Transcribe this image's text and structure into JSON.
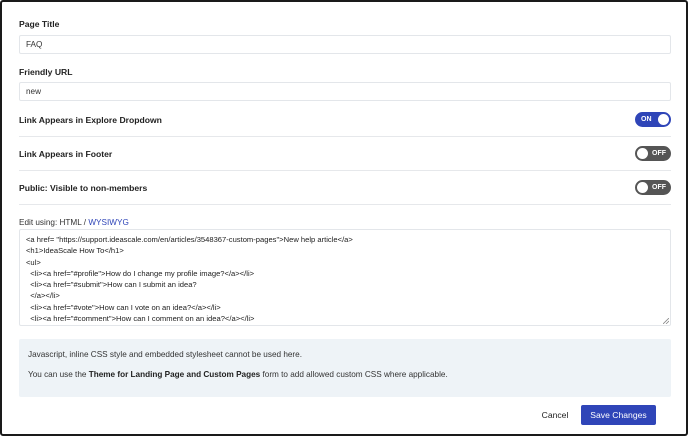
{
  "form": {
    "page_title": {
      "label": "Page Title",
      "value": "FAQ"
    },
    "friendly_url": {
      "label": "Friendly URL",
      "value": "new"
    },
    "toggles": [
      {
        "label": "Link Appears in Explore Dropdown",
        "state": "ON"
      },
      {
        "label": "Link Appears in Footer",
        "state": "OFF"
      },
      {
        "label": "Public: Visible to non-members",
        "state": "OFF"
      }
    ],
    "editor": {
      "prefix": "Edit using: HTML / ",
      "wysiwyg_link": "WYSIWYG",
      "lines": [
        "<a href= \"https://support.ideascale.com/en/articles/3548367-custom-pages\">New help article</a>",
        "<h1>IdeaScale How To</h1>",
        "<ul>",
        "  <li><a href=\"#profile\">How do I change my profile image?</a></li>",
        "  <li><a href=\"#submit\">How can I submit an idea?",
        "  </a></li>",
        "  <li><a href=\"#vote\">How can I vote on an idea?</a></li>",
        "  <li><a href=\"#comment\">How can I comment on an idea?</a></li>"
      ]
    },
    "info": {
      "line1": "Javascript, inline CSS style and embedded stylesheet cannot be used here.",
      "line2_prefix": "You can use the ",
      "line2_bold": "Theme for Landing Page and Custom Pages",
      "line2_suffix": " form to add allowed custom CSS where applicable."
    },
    "actions": {
      "cancel": "Cancel",
      "save": "Save Changes"
    },
    "colors": {
      "accent": "#2f45b8",
      "toggle_off": "#555555",
      "info_bg": "#eef3f7"
    }
  }
}
